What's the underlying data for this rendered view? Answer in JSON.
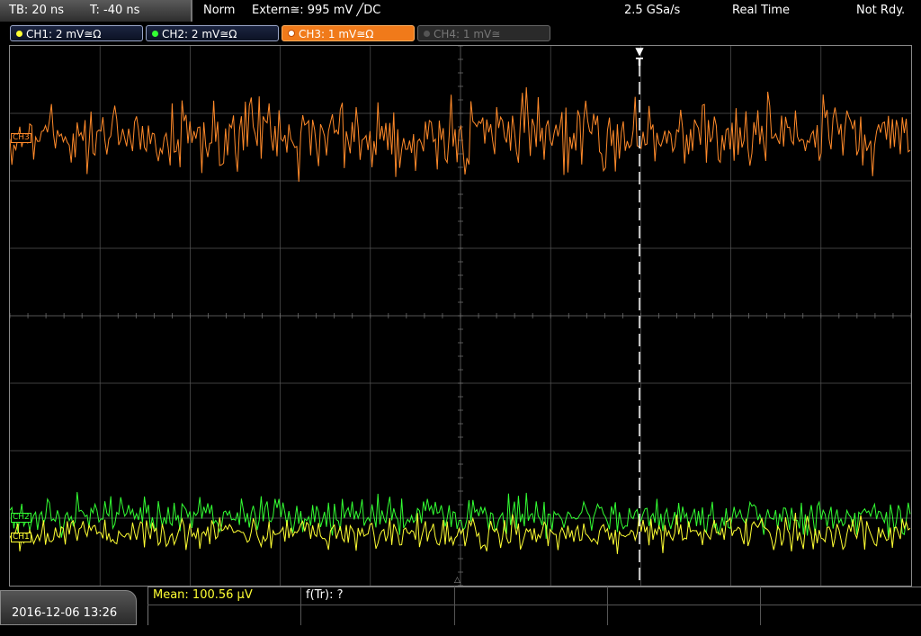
{
  "topbar": {
    "timebase": "TB: 20 ns",
    "trigger_offset": "T: -40 ns",
    "acq_mode": "Norm",
    "trigger_source": "Extern≅: 995 mV ╱DC",
    "sample_rate": "2.5 GSa/s",
    "mode": "Real Time",
    "status": "Not Rdy."
  },
  "channels": [
    {
      "label": "CH1: 2 mV≅Ω",
      "color": "#ffff33",
      "state": "on"
    },
    {
      "label": "CH2: 2 mV≅Ω",
      "color": "#33ff33",
      "state": "on"
    },
    {
      "label": "CH3: 1 mV≅Ω",
      "color": "#ff8a2a",
      "state": "active"
    },
    {
      "label": "CH4: 1 mV≅",
      "color": "#888888",
      "state": "off"
    }
  ],
  "markers": {
    "ch3": "CH3",
    "ch2": "CH2",
    "ch1": "CH1",
    "trigger": "T"
  },
  "footer": {
    "datetime": "2016-12-06 13:26",
    "mean": "Mean: 100.56 µV",
    "freq": "f(Tr): ?"
  },
  "colors": {
    "ch1": "#ffff33",
    "ch2": "#33ff33",
    "ch3": "#ff8a2a",
    "grid": "#555555"
  }
}
